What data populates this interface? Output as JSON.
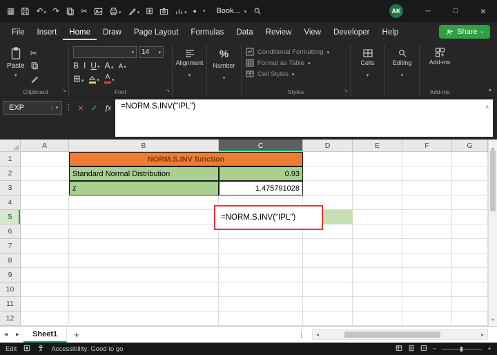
{
  "colors": {
    "accent_green": "#21a366",
    "share_green": "#2f9e44",
    "header_orange": "#ed7d31",
    "header_text_dark_red": "#843c0c",
    "cell_green": "#a9d08e",
    "selection_fill_green": "#c6e0b4",
    "annotation_red": "#e23b3b",
    "avatar_green": "#217346"
  },
  "titlebar": {
    "workbook_title": "Book...",
    "avatar_initials": "AK"
  },
  "menu": {
    "items": [
      "File",
      "Insert",
      "Home",
      "Draw",
      "Page Layout",
      "Formulas",
      "Data",
      "Review",
      "View",
      "Developer",
      "Help"
    ],
    "active_item": "Home",
    "share_label": "Share"
  },
  "ribbon": {
    "paste_label": "Paste",
    "font_size": "14",
    "bold": "B",
    "italic": "I",
    "underline": "U",
    "grow_font": "A",
    "shrink_font": "A",
    "font_color": "A",
    "alignment_label": "Alignment",
    "number_label": "Number",
    "styles_items": [
      "Conditional Formatting",
      "Format as Table",
      "Cell Styles"
    ],
    "cells_label": "Cells",
    "editing_label": "Editing",
    "addins_label": "Add-ins",
    "group_labels": {
      "clipboard": "Clipboard",
      "font": "Font",
      "styles": "Styles",
      "addins": "Add-ins"
    }
  },
  "formula_bar": {
    "name_box": "EXP",
    "formula": "=NORM.S.INV(\"IPL\")"
  },
  "grid": {
    "columns": [
      "A",
      "B",
      "C",
      "D",
      "E",
      "F",
      "G"
    ],
    "selected_column": "C",
    "rows": [
      "1",
      "2",
      "3",
      "4",
      "5",
      "6",
      "7",
      "8",
      "9",
      "10",
      "11",
      "12"
    ],
    "selected_row": "5",
    "cells": {
      "b1_title": "NORM.S.INV function",
      "b2": "Standard Normal Distribution",
      "c2": "0.93",
      "b3": "z",
      "c3": "1.475791028",
      "c5_formula": "=NORM.S.INV(\"IPL\")"
    }
  },
  "sheet_bar": {
    "active_tab": "Sheet1"
  },
  "status_bar": {
    "mode": "Edit",
    "accessibility": "Accessibility: Good to go"
  }
}
